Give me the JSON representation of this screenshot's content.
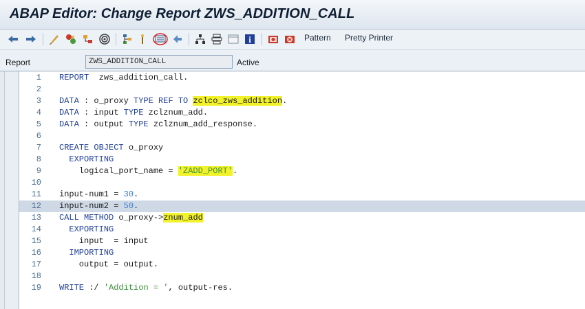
{
  "window": {
    "title": "ABAP Editor: Change Report ZWS_ADDITION_CALL"
  },
  "toolbar": {
    "icons": [
      "arrow-left-icon",
      "arrow-right-icon",
      "check-syntax-icon",
      "activate-icon",
      "object-tree-icon",
      "display-object-list-icon",
      "where-used-icon",
      "navigation-window-icon",
      "pattern-insert-icon",
      "split-screen-icon",
      "hierarchy-icon",
      "block-icon",
      "layout-icon",
      "info-icon",
      "breakpoint-icon",
      "watchpoint-icon"
    ],
    "pattern_label": "Pattern",
    "pretty_printer_label": "Pretty Printer"
  },
  "field": {
    "label": "Report",
    "value": "ZWS_ADDITION_CALL",
    "status": "Active"
  },
  "colors": {
    "keyword": "#1f3f99",
    "number": "#3b7bd6",
    "string": "#3a8f3a",
    "highlight": "#f2f22b"
  },
  "editor": {
    "highlighted_line": 12,
    "lines": [
      {
        "n": "1",
        "segs": [
          {
            "t": "REPORT",
            "c": "kw"
          },
          {
            "t": "  zws_addition_call."
          }
        ]
      },
      {
        "n": "2",
        "segs": []
      },
      {
        "n": "3",
        "segs": [
          {
            "t": "DATA",
            "c": "kw"
          },
          {
            "t": " : o_proxy "
          },
          {
            "t": "TYPE REF TO",
            "c": "kw"
          },
          {
            "t": " "
          },
          {
            "t": "zclco_zws_addition",
            "y": true
          },
          {
            "t": "."
          }
        ]
      },
      {
        "n": "4",
        "segs": [
          {
            "t": "DATA",
            "c": "kw"
          },
          {
            "t": " : input "
          },
          {
            "t": "TYPE",
            "c": "kw"
          },
          {
            "t": " zclznum_add."
          }
        ]
      },
      {
        "n": "5",
        "segs": [
          {
            "t": "DATA",
            "c": "kw"
          },
          {
            "t": " : output "
          },
          {
            "t": "TYPE",
            "c": "kw"
          },
          {
            "t": " zclznum_add_response."
          }
        ]
      },
      {
        "n": "6",
        "segs": []
      },
      {
        "n": "7",
        "segs": [
          {
            "t": "CREATE OBJECT",
            "c": "kw"
          },
          {
            "t": " o_proxy"
          }
        ]
      },
      {
        "n": "8",
        "segs": [
          {
            "t": "  "
          },
          {
            "t": "EXPORTING",
            "c": "kw"
          }
        ]
      },
      {
        "n": "9",
        "segs": [
          {
            "t": "    logical_port_name = "
          },
          {
            "t": "'ZADD_PORT'",
            "c": "str",
            "y": true
          },
          {
            "t": "."
          }
        ]
      },
      {
        "n": "10",
        "segs": []
      },
      {
        "n": "11",
        "segs": [
          {
            "t": "input-num1 = "
          },
          {
            "t": "30",
            "c": "num"
          },
          {
            "t": "."
          }
        ]
      },
      {
        "n": "12",
        "segs": [
          {
            "t": "input-num2 = "
          },
          {
            "t": "50",
            "c": "num"
          },
          {
            "t": "."
          }
        ]
      },
      {
        "n": "13",
        "segs": [
          {
            "t": "CALL METHOD",
            "c": "kw"
          },
          {
            "t": " o_proxy->"
          },
          {
            "t": "znum_add",
            "y": true
          }
        ]
      },
      {
        "n": "14",
        "segs": [
          {
            "t": "  "
          },
          {
            "t": "EXPORTING",
            "c": "kw"
          }
        ]
      },
      {
        "n": "15",
        "segs": [
          {
            "t": "    input  = input"
          }
        ]
      },
      {
        "n": "16",
        "segs": [
          {
            "t": "  "
          },
          {
            "t": "IMPORTING",
            "c": "kw"
          }
        ]
      },
      {
        "n": "17",
        "segs": [
          {
            "t": "    output = output."
          }
        ]
      },
      {
        "n": "18",
        "segs": []
      },
      {
        "n": "19",
        "segs": [
          {
            "t": "WRITE",
            "c": "kw"
          },
          {
            "t": " :/ "
          },
          {
            "t": "'Addition = '",
            "c": "str"
          },
          {
            "t": ", output-res."
          }
        ]
      }
    ]
  }
}
